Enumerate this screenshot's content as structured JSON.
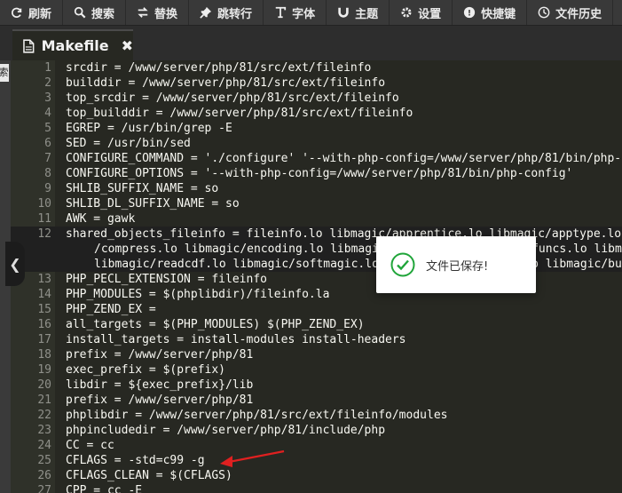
{
  "toolbar": {
    "items": [
      {
        "label": "刷新",
        "icon": "refresh-icon"
      },
      {
        "label": "搜索",
        "icon": "search-icon"
      },
      {
        "label": "替换",
        "icon": "replace-icon"
      },
      {
        "label": "跳转行",
        "icon": "pushpin-icon"
      },
      {
        "label": "字体",
        "icon": "font-icon"
      },
      {
        "label": "主题",
        "icon": "magnet-icon"
      },
      {
        "label": "设置",
        "icon": "gear-icon"
      },
      {
        "label": "快捷键",
        "icon": "keyboard-icon"
      },
      {
        "label": "文件历史",
        "icon": "clock-icon"
      }
    ]
  },
  "tab": {
    "name": "Makefile",
    "icon": "file-icon",
    "close": "✖"
  },
  "sidebar": {
    "label": "索"
  },
  "editor": {
    "lines": [
      {
        "n": "1",
        "text": "srcdir = /www/server/php/81/src/ext/fileinfo"
      },
      {
        "n": "2",
        "text": "builddir = /www/server/php/81/src/ext/fileinfo"
      },
      {
        "n": "3",
        "text": "top_srcdir = /www/server/php/81/src/ext/fileinfo"
      },
      {
        "n": "4",
        "text": "top_builddir = /www/server/php/81/src/ext/fileinfo"
      },
      {
        "n": "5",
        "text": "EGREP = /usr/bin/grep -E"
      },
      {
        "n": "6",
        "text": "SED = /usr/bin/sed"
      },
      {
        "n": "7",
        "text": "CONFIGURE_COMMAND = './configure' '--with-php-config=/www/server/php/81/bin/php-config'"
      },
      {
        "n": "8",
        "text": "CONFIGURE_OPTIONS = '--with-php-config=/www/server/php/81/bin/php-config'"
      },
      {
        "n": "9",
        "text": "SHLIB_SUFFIX_NAME = so"
      },
      {
        "n": "10",
        "text": "SHLIB_DL_SUFFIX_NAME = so"
      },
      {
        "n": "11",
        "text": "AWK = gawk"
      },
      {
        "n": "12",
        "text": "shared_objects_fileinfo = fileinfo.lo libmagic/apprentice.lo libmagic/apptype.lo libmagic/ascmagic.lo libmagic/cdf.lo"
      },
      {
        "n": "13",
        "text": "PHP_PECL_EXTENSION = fileinfo"
      },
      {
        "n": "14",
        "text": "PHP_MODULES = $(phplibdir)/fileinfo.la"
      },
      {
        "n": "15",
        "text": "PHP_ZEND_EX ="
      },
      {
        "n": "16",
        "text": "all_targets = $(PHP_MODULES) $(PHP_ZEND_EX)"
      },
      {
        "n": "17",
        "text": "install_targets = install-modules install-headers"
      },
      {
        "n": "18",
        "text": "prefix = /www/server/php/81"
      },
      {
        "n": "19",
        "text": "exec_prefix = $(prefix)"
      },
      {
        "n": "20",
        "text": "libdir = ${exec_prefix}/lib"
      },
      {
        "n": "21",
        "text": "prefix = /www/server/php/81"
      },
      {
        "n": "22",
        "text": "phplibdir = /www/server/php/81/src/ext/fileinfo/modules"
      },
      {
        "n": "23",
        "text": "phpincludedir = /www/server/php/81/include/php"
      },
      {
        "n": "24",
        "text": "CC = cc"
      },
      {
        "n": "25",
        "text": "CFLAGS = -std=c99 -g"
      },
      {
        "n": "26",
        "text": "CFLAGS_CLEAN = $(CFLAGS)"
      },
      {
        "n": "27",
        "text": "CPP = cc -E"
      }
    ],
    "wrap_lines": [
      "/compress.lo libmagic/encoding.lo libmagic/fsmagic.lo libmagic/funcs.lo libmagic/is_tar.lo",
      "libmagic/readcdf.lo libmagic/softmagic.lo libmagic/strcasestr.lo libmagic/buffer.lo libmagic/is_csv.lo"
    ]
  },
  "toast": {
    "message": "文件已保存!",
    "icon": "check-circle-icon"
  },
  "colors": {
    "toast_check": "#20a53a",
    "annotation_arrow": "#e02020"
  }
}
